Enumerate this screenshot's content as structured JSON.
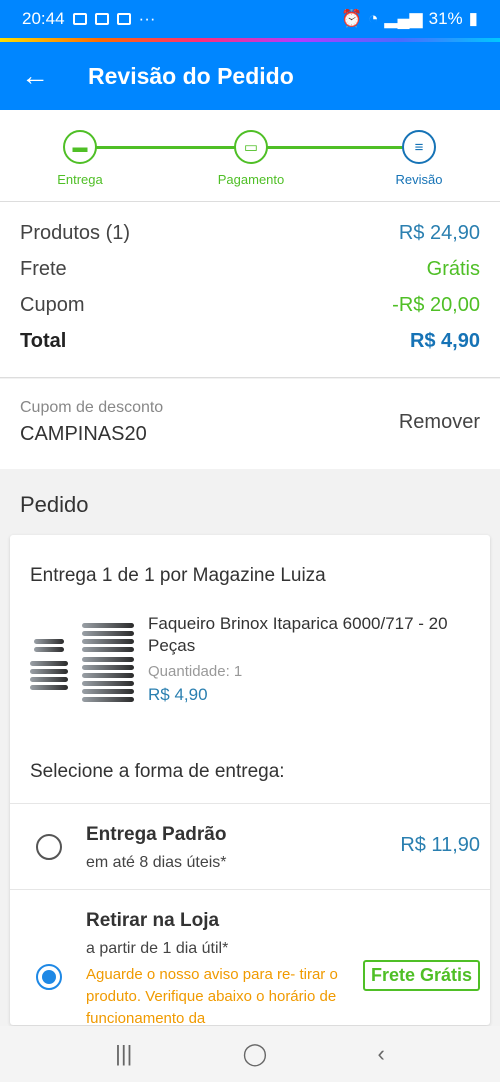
{
  "status_bar": {
    "time": "20:44",
    "dots": "···",
    "battery": "31%",
    "notification_icons": [
      "gallery-icon",
      "mail-icon",
      "video-icon"
    ],
    "system_icons": [
      "alarm-icon",
      "wifi-icon",
      "signal-icon",
      "battery-icon"
    ]
  },
  "header": {
    "title": "Revisão do Pedido",
    "back_icon": "arrow-left-icon"
  },
  "steps": [
    {
      "label": "Entrega",
      "icon": "truck-icon"
    },
    {
      "label": "Pagamento",
      "icon": "card-icon"
    },
    {
      "label": "Revisão",
      "icon": "list-icon"
    }
  ],
  "summary": {
    "products_label": "Produtos (1)",
    "products_value": "R$ 24,90",
    "shipping_label": "Frete",
    "shipping_value": "Grátis",
    "coupon_label": "Cupom",
    "coupon_value": "-R$ 20,00",
    "total_label": "Total",
    "total_value": "R$ 4,90"
  },
  "coupon": {
    "label": "Cupom de desconto",
    "code": "CAMPINAS20",
    "remove_label": "Remover"
  },
  "order": {
    "section_title": "Pedido",
    "delivery_title": "Entrega 1 de 1 por Magazine Luiza",
    "product": {
      "name": "Faqueiro Brinox Itaparica 6000/717 - 20 Peças",
      "quantity_label": "Quantidade:",
      "quantity": "1",
      "price": "R$ 4,90"
    },
    "select_title": "Selecione a forma de entrega:",
    "options": [
      {
        "title": "Entrega Padrão",
        "subtitle": "em até 8 dias úteis*",
        "price": "R$ 11,90",
        "selected": false
      },
      {
        "title": "Retirar na Loja",
        "subtitle": "a partir de 1 dia útil*",
        "note": "Aguarde o nosso aviso para re- tirar o produto. Verifique abaixo o horário de funcionamento da",
        "badge": "Frete Grátis",
        "selected": true
      }
    ]
  },
  "nav": {
    "recents": "|||",
    "home": "◯",
    "back": "‹"
  },
  "colors": {
    "primary": "#0086ff",
    "green": "#4fbf26",
    "blue": "#1673b6",
    "orange": "#f09a00"
  }
}
